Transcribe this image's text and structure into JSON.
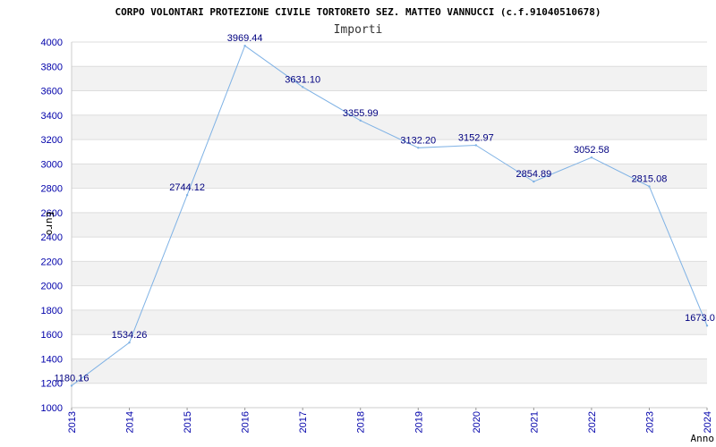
{
  "chart_data": {
    "type": "line",
    "title": "CORPO VOLONTARI PROTEZIONE CIVILE TORTORETO SEZ. MATTEO VANNUCCI (c.f.91040510678)",
    "subtitle": "Importi",
    "xlabel": "Anno",
    "ylabel": "Euro",
    "x": [
      "2013",
      "2014",
      "2015",
      "2016",
      "2017",
      "2018",
      "2019",
      "2020",
      "2021",
      "2022",
      "2023",
      "2024"
    ],
    "series": [
      {
        "values": [
          1180.16,
          1534.26,
          2744.12,
          3969.44,
          3631.1,
          3355.99,
          3132.2,
          3152.97,
          2854.89,
          3052.58,
          2815.08,
          1673.0
        ],
        "labels": [
          "1180.16",
          "1534.26",
          "2744.12",
          "3969.44",
          "3631.10",
          "3355.99",
          "3132.20",
          "3152.97",
          "2854.89",
          "3052.58",
          "2815.08",
          "1673.0"
        ]
      }
    ],
    "ylim": [
      1000,
      4000
    ],
    "yticks": [
      "1000",
      "1200",
      "1400",
      "1600",
      "1800",
      "2000",
      "2200",
      "2400",
      "2600",
      "2800",
      "3000",
      "3200",
      "3400",
      "3600",
      "3800",
      "4000"
    ],
    "grid": true,
    "colors": {
      "line": "#7fb2e5",
      "band": "#f2f2f2",
      "gridline": "#dddddd",
      "tick_text": "#0000aa",
      "label_text": "#000080"
    }
  }
}
